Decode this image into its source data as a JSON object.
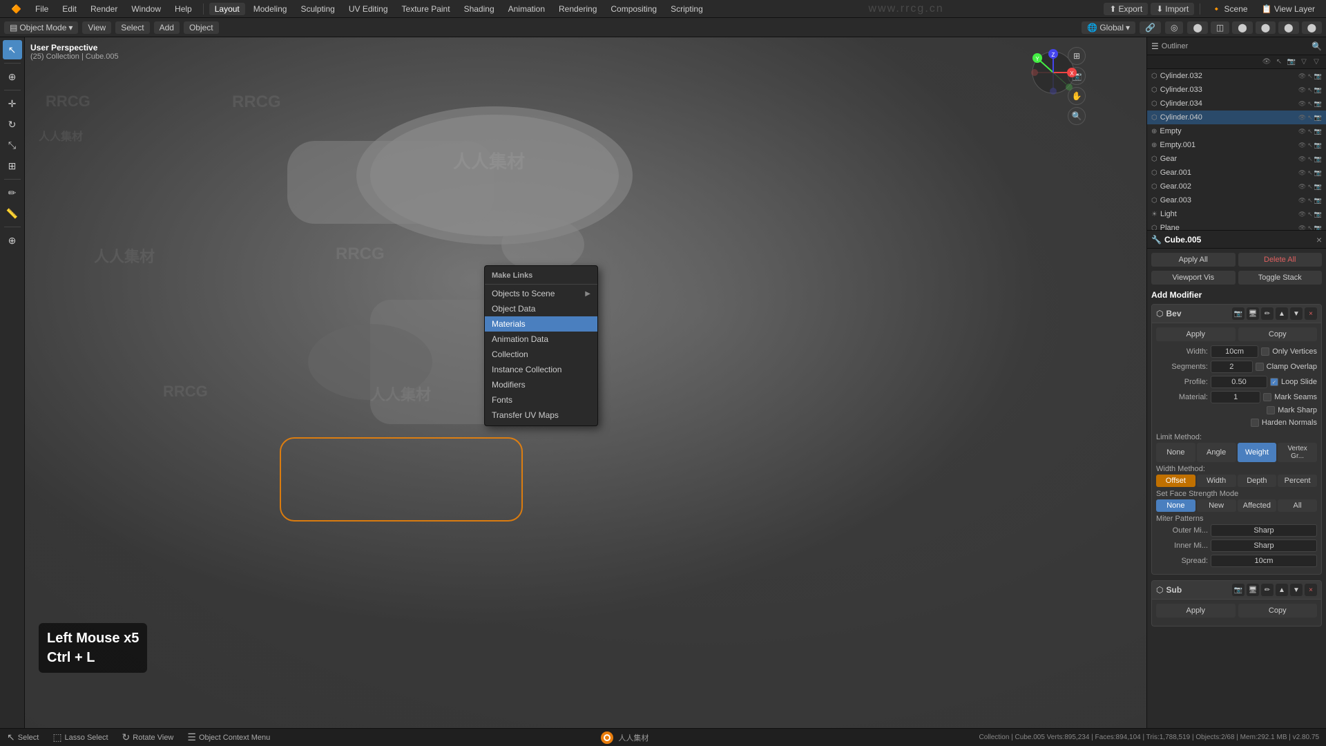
{
  "app": {
    "title": "Blender",
    "version": "v2.80.75"
  },
  "top_menu": {
    "items": [
      "Blender",
      "File",
      "Edit",
      "Render",
      "Window",
      "Help",
      "Layout",
      "Modeling",
      "Sculpting",
      "UV Editing",
      "Texture Paint",
      "Shading",
      "Animation",
      "Rendering",
      "Compositing",
      "Scripting"
    ],
    "active": "Layout",
    "right_items": [
      "Export",
      "Import"
    ]
  },
  "second_toolbar": {
    "mode": "Object Mode",
    "view": "View",
    "select": "Select",
    "add": "Add",
    "object": "Object",
    "transform": "Global",
    "snap_label": "Snap"
  },
  "viewport": {
    "view_name": "User Perspective",
    "collection": "(25) Collection | Cube.005",
    "watermarks": [
      "RRCG",
      "人人集材"
    ]
  },
  "context_menu": {
    "header": "Make Links",
    "items": [
      {
        "label": "Objects to Scene",
        "has_arrow": true
      },
      {
        "label": "Object Data",
        "has_arrow": false
      },
      {
        "label": "Materials",
        "has_arrow": false,
        "highlighted": true
      },
      {
        "label": "Animation Data",
        "has_arrow": false
      },
      {
        "label": "Collection",
        "has_arrow": false
      },
      {
        "label": "Instance Collection",
        "has_arrow": false
      },
      {
        "label": "Modifiers",
        "has_arrow": false
      },
      {
        "label": "Fonts",
        "has_arrow": false
      },
      {
        "label": "Transfer UV Maps",
        "has_arrow": false
      }
    ]
  },
  "key_display": {
    "line1": "Left Mouse x5",
    "line2": "Ctrl + L"
  },
  "outliner": {
    "header_label": "Outliner",
    "items": [
      {
        "name": "Cylinder.032",
        "icon": "⬡",
        "selected": false
      },
      {
        "name": "Cylinder.033",
        "icon": "⬡",
        "selected": false
      },
      {
        "name": "Cylinder.034",
        "icon": "⬡",
        "selected": false
      },
      {
        "name": "Cylinder.040",
        "icon": "⬡",
        "selected": true
      },
      {
        "name": "Empty",
        "icon": "⊕",
        "selected": false
      },
      {
        "name": "Empty.001",
        "icon": "⊕",
        "selected": false
      },
      {
        "name": "Gear",
        "icon": "⬡",
        "selected": false
      },
      {
        "name": "Gear.001",
        "icon": "⬡",
        "selected": false
      },
      {
        "name": "Gear.002",
        "icon": "⬡",
        "selected": false
      },
      {
        "name": "Gear.003",
        "icon": "⬡",
        "selected": false
      },
      {
        "name": "Light",
        "icon": "☀",
        "selected": false
      },
      {
        "name": "Plane",
        "icon": "⬡",
        "selected": false
      }
    ]
  },
  "properties": {
    "object_name": "Cube.005",
    "panel_tabs": [
      "scene",
      "render",
      "output",
      "view_layer",
      "scene_props",
      "world",
      "object",
      "modifier",
      "particles",
      "physics",
      "constraints",
      "data",
      "material"
    ],
    "active_tab": "modifier",
    "apply_all_btn": "Apply All",
    "delete_all_btn": "Delete All",
    "viewport_vis_btn": "Viewport Vis",
    "toggle_stack_btn": "Toggle Stack",
    "add_modifier_label": "Add Modifier",
    "modifier": {
      "name": "Bev",
      "apply_btn": "Apply",
      "copy_btn": "Copy",
      "width_label": "Width:",
      "width_value": "10cm",
      "segments_label": "Segments:",
      "segments_value": "2",
      "profile_label": "Profile:",
      "profile_value": "0.50",
      "material_label": "Material:",
      "material_value": "1",
      "checkboxes": [
        {
          "label": "Only Vertices",
          "checked": false
        },
        {
          "label": "Clamp Overlap",
          "checked": false
        },
        {
          "label": "Loop Slide",
          "checked": true
        },
        {
          "label": "Mark Seams",
          "checked": false
        },
        {
          "label": "Mark Sharp",
          "checked": false
        },
        {
          "label": "Harden Normals",
          "checked": false
        }
      ],
      "limit_method_label": "Limit Method:",
      "limit_method_buttons": [
        "None",
        "Angle",
        "Weight",
        "Vertex Gr..."
      ],
      "limit_active": "Weight",
      "width_method_label": "Width Method:",
      "width_method_buttons": [
        "Offset",
        "Width",
        "Depth",
        "Percent"
      ],
      "width_active": "Offset",
      "face_strength_label": "Set Face Strength Mode",
      "face_strength_buttons": [
        "None",
        "New",
        "Affected",
        "All"
      ],
      "face_active": "None",
      "miter_label": "Miter Patterns",
      "outer_mi_label": "Outer Mi...",
      "outer_mi_value": "Sharp",
      "inner_mi_label": "Inner Mi...",
      "inner_mi_value": "Sharp",
      "spread_label": "Spread:",
      "spread_value": "10cm"
    },
    "second_modifier": {
      "name": "Sub",
      "apply_btn": "Apply",
      "copy_btn": "Copy"
    }
  },
  "status_bar": {
    "select_label": "Select",
    "lasso_label": "Lasso Select",
    "rotate_label": "Rotate View",
    "context_label": "Object Context Menu",
    "stats": "Collection | Cube.005   Verts:895,234 | Faces:894,104 | Tris:1,788,519 | Objects:2/68 | Mem:292.1 MB | v2.80.75"
  }
}
